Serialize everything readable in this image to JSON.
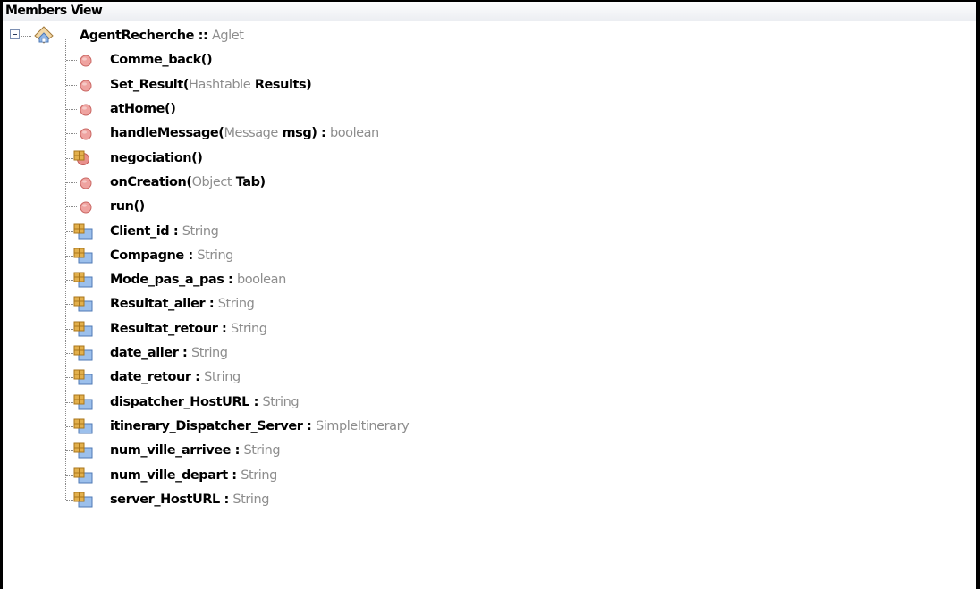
{
  "panel": {
    "title": "Members View"
  },
  "root": {
    "name": "AgentRecherche",
    "separator": " :: ",
    "type": "Aglet",
    "icon": "class-icon"
  },
  "members": [
    {
      "kind": "method",
      "icon": "public-method-icon",
      "parts": [
        {
          "t": "Comme_back()",
          "s": "n"
        }
      ]
    },
    {
      "kind": "method",
      "icon": "public-method-icon",
      "parts": [
        {
          "t": "Set_Result(",
          "s": "n"
        },
        {
          "t": "Hashtable",
          "s": "t"
        },
        {
          "t": " Results)",
          "s": "n"
        }
      ]
    },
    {
      "kind": "method",
      "icon": "public-method-icon",
      "parts": [
        {
          "t": "atHome()",
          "s": "n"
        }
      ]
    },
    {
      "kind": "method",
      "icon": "public-method-icon",
      "parts": [
        {
          "t": "handleMessage(",
          "s": "n"
        },
        {
          "t": "Message",
          "s": "t"
        },
        {
          "t": " msg) : ",
          "s": "n"
        },
        {
          "t": "boolean",
          "s": "t"
        }
      ]
    },
    {
      "kind": "method",
      "icon": "package-method-icon",
      "parts": [
        {
          "t": "negociation()",
          "s": "n"
        }
      ]
    },
    {
      "kind": "method",
      "icon": "public-method-icon",
      "parts": [
        {
          "t": "onCreation(",
          "s": "n"
        },
        {
          "t": "Object",
          "s": "t"
        },
        {
          "t": " Tab)",
          "s": "n"
        }
      ]
    },
    {
      "kind": "method",
      "icon": "public-method-icon",
      "parts": [
        {
          "t": "run()",
          "s": "n"
        }
      ]
    },
    {
      "kind": "field",
      "icon": "package-field-icon",
      "parts": [
        {
          "t": "Client_id : ",
          "s": "n"
        },
        {
          "t": "String",
          "s": "t"
        }
      ]
    },
    {
      "kind": "field",
      "icon": "package-field-icon",
      "parts": [
        {
          "t": "Compagne : ",
          "s": "n"
        },
        {
          "t": "String",
          "s": "t"
        }
      ]
    },
    {
      "kind": "field",
      "icon": "package-field-icon",
      "parts": [
        {
          "t": "Mode_pas_a_pas : ",
          "s": "n"
        },
        {
          "t": "boolean",
          "s": "t"
        }
      ]
    },
    {
      "kind": "field",
      "icon": "package-field-icon",
      "parts": [
        {
          "t": "Resultat_aller : ",
          "s": "n"
        },
        {
          "t": "String",
          "s": "t"
        }
      ]
    },
    {
      "kind": "field",
      "icon": "package-field-icon",
      "parts": [
        {
          "t": "Resultat_retour : ",
          "s": "n"
        },
        {
          "t": "String",
          "s": "t"
        }
      ]
    },
    {
      "kind": "field",
      "icon": "package-field-icon",
      "parts": [
        {
          "t": "date_aller : ",
          "s": "n"
        },
        {
          "t": "String",
          "s": "t"
        }
      ]
    },
    {
      "kind": "field",
      "icon": "package-field-icon",
      "parts": [
        {
          "t": "date_retour : ",
          "s": "n"
        },
        {
          "t": "String",
          "s": "t"
        }
      ]
    },
    {
      "kind": "field",
      "icon": "package-field-icon",
      "parts": [
        {
          "t": "dispatcher_HostURL : ",
          "s": "n"
        },
        {
          "t": "String",
          "s": "t"
        }
      ]
    },
    {
      "kind": "field",
      "icon": "package-field-icon",
      "parts": [
        {
          "t": "itinerary_Dispatcher_Server : ",
          "s": "n"
        },
        {
          "t": "SimpleItinerary",
          "s": "t"
        }
      ]
    },
    {
      "kind": "field",
      "icon": "package-field-icon",
      "parts": [
        {
          "t": "num_ville_arrivee : ",
          "s": "n"
        },
        {
          "t": "String",
          "s": "t"
        }
      ]
    },
    {
      "kind": "field",
      "icon": "package-field-icon",
      "parts": [
        {
          "t": "num_ville_depart : ",
          "s": "n"
        },
        {
          "t": "String",
          "s": "t"
        }
      ]
    },
    {
      "kind": "field",
      "icon": "package-field-icon",
      "parts": [
        {
          "t": "server_HostURL : ",
          "s": "n"
        },
        {
          "t": "String",
          "s": "t"
        }
      ]
    }
  ],
  "colors": {
    "name": "#000000",
    "type": "#8d8d8d",
    "method_icon": "#e48a8a",
    "field_icon": "#d9a23c"
  }
}
